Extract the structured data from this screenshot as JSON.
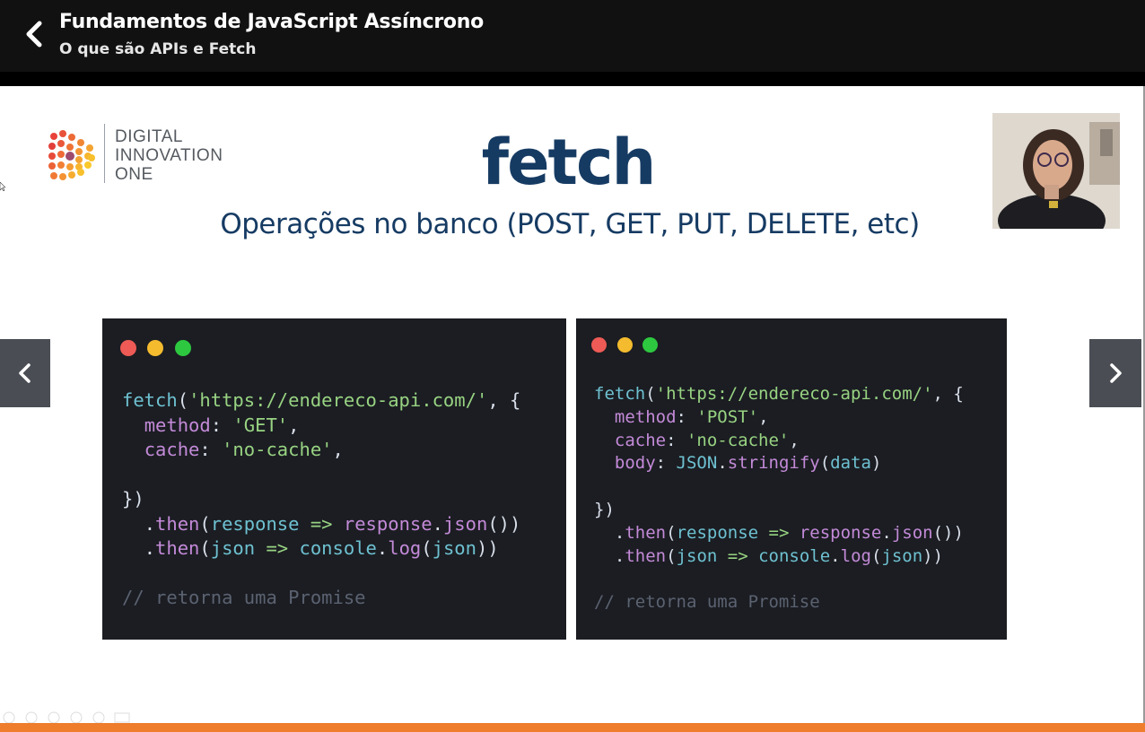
{
  "header": {
    "course_title": "Fundamentos de JavaScript Assíncrono",
    "lesson_title": "O que são APIs e Fetch",
    "back_icon": "chevron-left-icon"
  },
  "slide": {
    "logo": {
      "line1": "DIGITAL",
      "line2": "INNOVATION",
      "line3": "ONE"
    },
    "title": "fetch",
    "subtitle": "Operações no banco (POST, GET, PUT, DELETE, etc)",
    "code_left": {
      "l1a": "fetch",
      "l1b": "(",
      "l1c": "'https://endereco-api.com/'",
      "l1d": ", {",
      "l2a": "method",
      "l2b": ": ",
      "l2c": "'GET'",
      "l2d": ",",
      "l3a": "cache",
      "l3b": ": ",
      "l3c": "'no-cache'",
      "l3d": ",",
      "l5": "})",
      "l6a": ".",
      "l6b": "then",
      "l6c": "(",
      "l6d": "response",
      "l6e": " => ",
      "l6f": "response",
      "l6g": ".",
      "l6h": "json",
      "l6i": "())",
      "l7a": ".",
      "l7b": "then",
      "l7c": "(",
      "l7d": "json",
      "l7e": " => ",
      "l7f": "console",
      "l7g": ".",
      "l7h": "log",
      "l7i": "(",
      "l7j": "json",
      "l7k": "))",
      "l9": "// retorna uma Promise"
    },
    "code_right": {
      "l1a": "fetch",
      "l1b": "(",
      "l1c": "'https://endereco-api.com/'",
      "l1d": ", {",
      "l2a": "method",
      "l2b": ": ",
      "l2c": "'POST'",
      "l2d": ",",
      "l3a": "cache",
      "l3b": ": ",
      "l3c": "'no-cache'",
      "l3d": ",",
      "l4a": "body",
      "l4b": ": ",
      "l4c": "JSON",
      "l4d": ".",
      "l4e": "stringify",
      "l4f": "(",
      "l4g": "data",
      "l4h": ")",
      "l6": "})",
      "l7a": ".",
      "l7b": "then",
      "l7c": "(",
      "l7d": "response",
      "l7e": " => ",
      "l7f": "response",
      "l7g": ".",
      "l7h": "json",
      "l7i": "())",
      "l8a": ".",
      "l8b": "then",
      "l8c": "(",
      "l8d": "json",
      "l8e": " => ",
      "l8f": "console",
      "l8g": ".",
      "l8h": "log",
      "l8i": "(",
      "l8j": "json",
      "l8k": "))",
      "l10": "// retorna uma Promise"
    }
  },
  "navigation": {
    "prev_icon": "chevron-left-icon",
    "next_icon": "chevron-right-icon"
  },
  "colors": {
    "header_bg": "#111111",
    "title_navy": "#163b63",
    "code_bg": "#1b1d22",
    "progress_orange": "#ee7d2c",
    "dot_red": "#ee5a55",
    "dot_yellow": "#f4bb2e",
    "dot_green": "#2dc840"
  }
}
